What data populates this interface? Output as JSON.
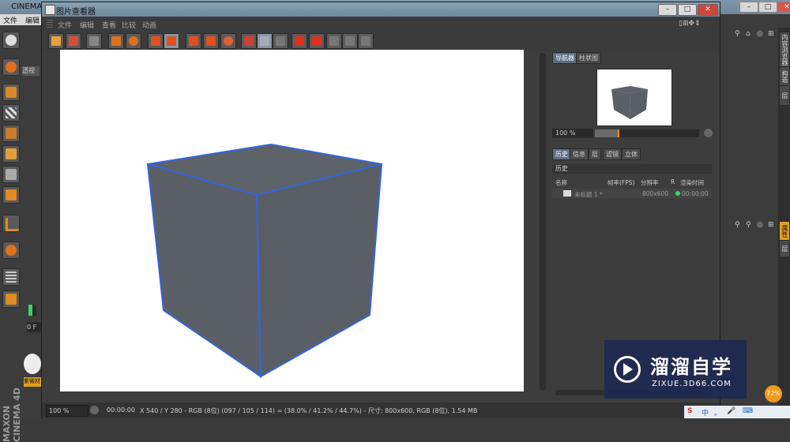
{
  "app": {
    "bg_title": "CINEMA",
    "bg_menu": [
      "文件",
      "编辑"
    ],
    "side_tabs": [
      "内容浏览器",
      "构造",
      "层"
    ],
    "side_tabs2": [
      "属性",
      "层"
    ],
    "logo": "MAXON CINEMA 4D",
    "material_label": "紫微材",
    "left_badge": "0 F",
    "left_label": "透视"
  },
  "viewer": {
    "title": "图片查看器",
    "menu": [
      "文件",
      "编辑",
      "查看",
      "比较",
      "动画"
    ],
    "canvas_bg": "#ffffff",
    "cube_face_color": "#5e6269",
    "cube_edge_color": "#3366dd"
  },
  "side": {
    "top_tabs": [
      "导航器",
      "柱状图"
    ],
    "zoom_value": "100 %",
    "zoom_fraction": 0.22,
    "bottom_tabs": [
      "历史",
      "信息",
      "层",
      "滤镜",
      "立体"
    ],
    "history_header": "历史",
    "columns": [
      "名称",
      "帧率(FPS)",
      "分辨率",
      "R",
      "渲染时间"
    ],
    "rows": [
      {
        "name": "未标题 1 *",
        "resolution": "800x600",
        "time": "00:00:00",
        "status_color": "#3ad36b"
      }
    ]
  },
  "status": {
    "zoom": "100 %",
    "time": "00:00:00",
    "info": "X 540 / Y 280 - RGB (8位) (097 / 105 / 114) = (38.0% / 41.2% / 44.7%) - 尺寸: 800x600, RGB (8位), 1.54 MB"
  },
  "watermark": {
    "title": "溜溜自学",
    "url": "ZIXUE.3D66.COM",
    "badge": "72%"
  },
  "tray": [
    "中",
    "。",
    "🎤",
    "⌨"
  ]
}
